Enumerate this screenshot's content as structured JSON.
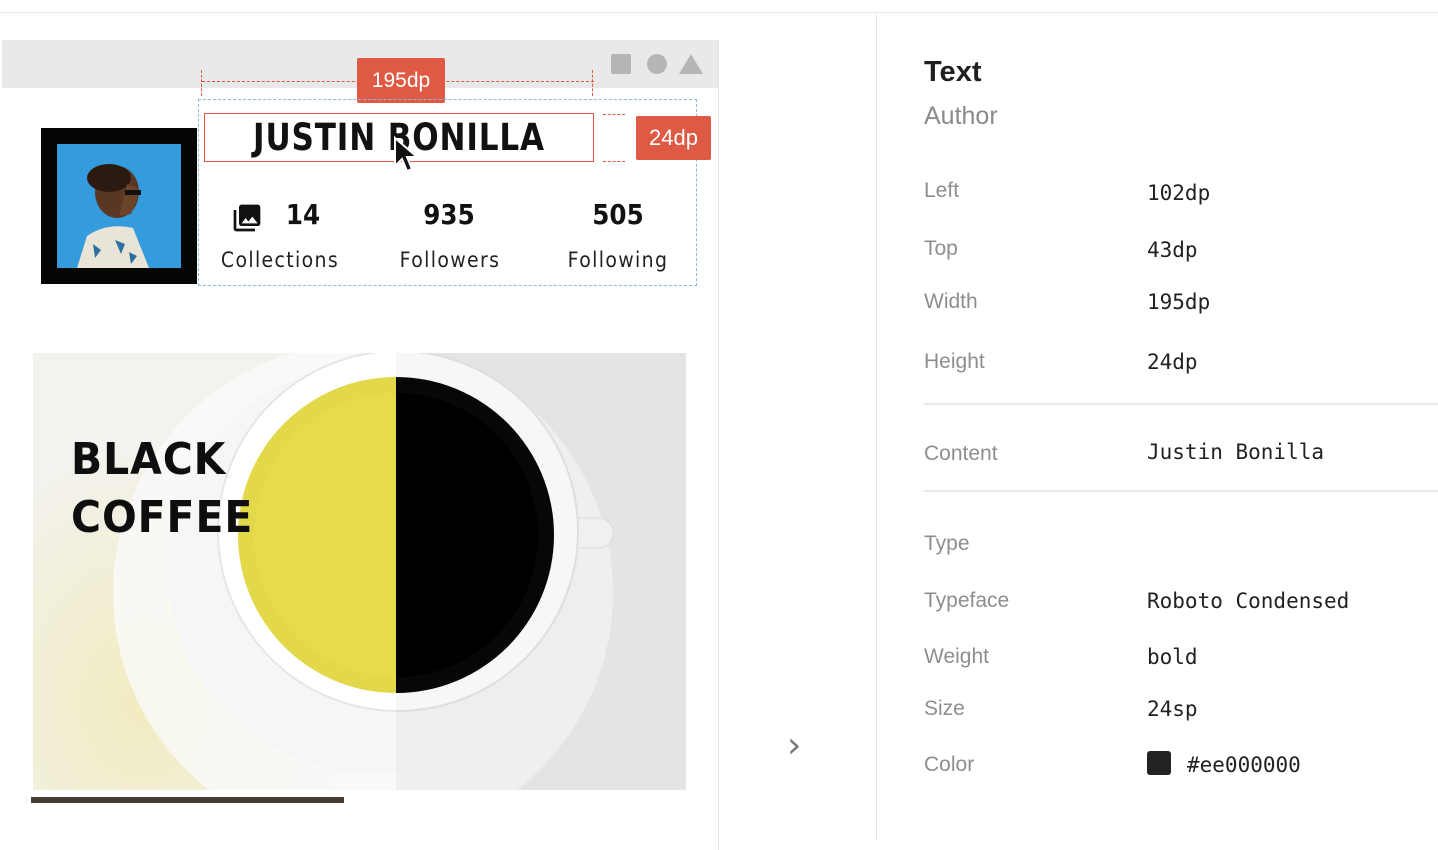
{
  "profile": {
    "name": "JUSTIN BONILLA",
    "stats": [
      {
        "value": "14",
        "label": "Collections"
      },
      {
        "value": "935",
        "label": "Followers"
      },
      {
        "value": "505",
        "label": "Following"
      }
    ]
  },
  "measure": {
    "width_badge": "195dp",
    "height_badge": "24dp"
  },
  "card": {
    "title_line1": "BLACK",
    "title_line2": "COFFEE"
  },
  "panel": {
    "title": "Text",
    "subtitle": "Author",
    "position": [
      {
        "label": "Left",
        "value": "102dp"
      },
      {
        "label": "Top",
        "value": "43dp"
      },
      {
        "label": "Width",
        "value": "195dp"
      },
      {
        "label": "Height",
        "value": "24dp"
      }
    ],
    "content": {
      "label": "Content",
      "value": "Justin Bonilla"
    },
    "type_heading": "Type",
    "type": [
      {
        "label": "Typeface",
        "value": "Roboto Condensed"
      },
      {
        "label": "Weight",
        "value": "bold"
      },
      {
        "label": "Size",
        "value": "24sp"
      }
    ],
    "color": {
      "label": "Color",
      "value": "#ee000000",
      "swatch": "#222222"
    }
  },
  "icons": {
    "statusbar": [
      "square-icon",
      "circle-icon",
      "triangle-icon"
    ],
    "gallery": "photo-library-icon",
    "cursor": "mouse-pointer-icon",
    "next": "chevron-right-icon"
  },
  "colors": {
    "accent": "#df5a45",
    "selection": "#8fb8e3"
  }
}
